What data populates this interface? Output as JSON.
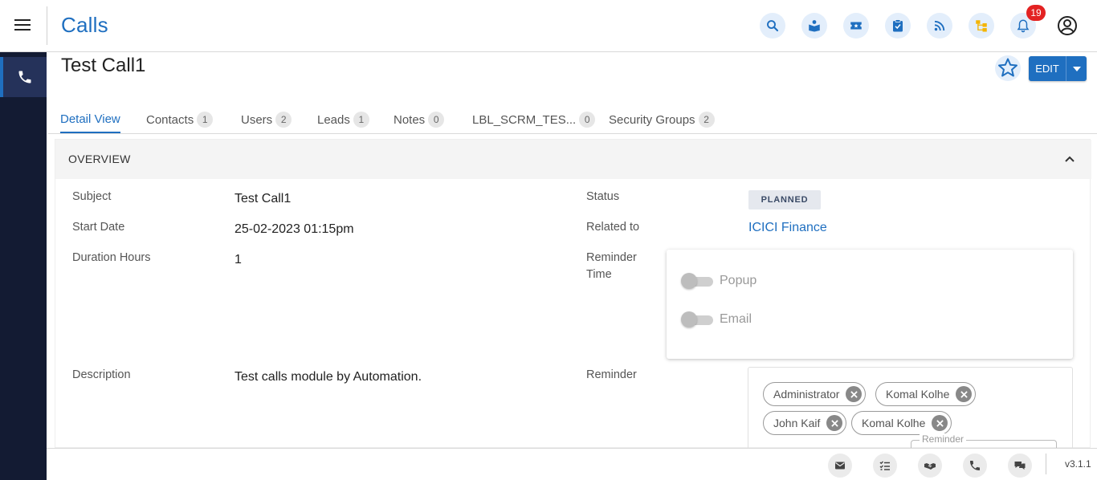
{
  "header": {
    "app_title": "Calls",
    "notification_count": "19",
    "icons": [
      "search-icon",
      "knowledge-base-icon",
      "tickets-icon",
      "tasks-icon",
      "feed-icon",
      "org-chart-icon",
      "bell-icon",
      "user-profile-icon"
    ]
  },
  "sidebar": {
    "active_icon": "phone-icon"
  },
  "record": {
    "title": "Test Call1",
    "edit_label": "EDIT"
  },
  "tabs": [
    {
      "label": "Detail View",
      "count": ""
    },
    {
      "label": "Contacts",
      "count": "1"
    },
    {
      "label": "Users",
      "count": "2"
    },
    {
      "label": "Leads",
      "count": "1"
    },
    {
      "label": "Notes",
      "count": "0"
    },
    {
      "label": "LBL_SCRM_TES...",
      "count": "0"
    },
    {
      "label": "Security Groups",
      "count": "2"
    }
  ],
  "overview": {
    "title": "OVERVIEW",
    "fields": {
      "subject_label": "Subject",
      "subject_value": "Test Call1",
      "start_date_label": "Start Date",
      "start_date_value": "25-02-2023 01:15pm",
      "duration_label": "Duration Hours",
      "duration_value": "1",
      "description_label": "Description",
      "description_value": "Test calls module by Automation.",
      "status_label": "Status",
      "status_value": "PLANNED",
      "related_label": "Related to",
      "related_value": "ICICI Finance",
      "reminder_time_label_1": "Reminder",
      "reminder_time_label_2": "Time",
      "reminder_label": "Reminder"
    },
    "reminder_time": {
      "popup_label": "Popup",
      "email_label": "Email",
      "popup_on": false,
      "email_on": false
    },
    "reminder": {
      "invitees": [
        "Administrator",
        "Komal Kolhe",
        "John Kaif",
        "Komal Kolhe"
      ],
      "sub_legend": "Reminder"
    }
  },
  "footer": {
    "icons": [
      "email-icon",
      "tasks-list-icon",
      "meetings-icon",
      "call-icon",
      "chat-icon"
    ],
    "version": "v3.1.1"
  },
  "colors": {
    "accent": "#1f6fc0",
    "rail": "#131b33",
    "badge": "#e32222"
  }
}
